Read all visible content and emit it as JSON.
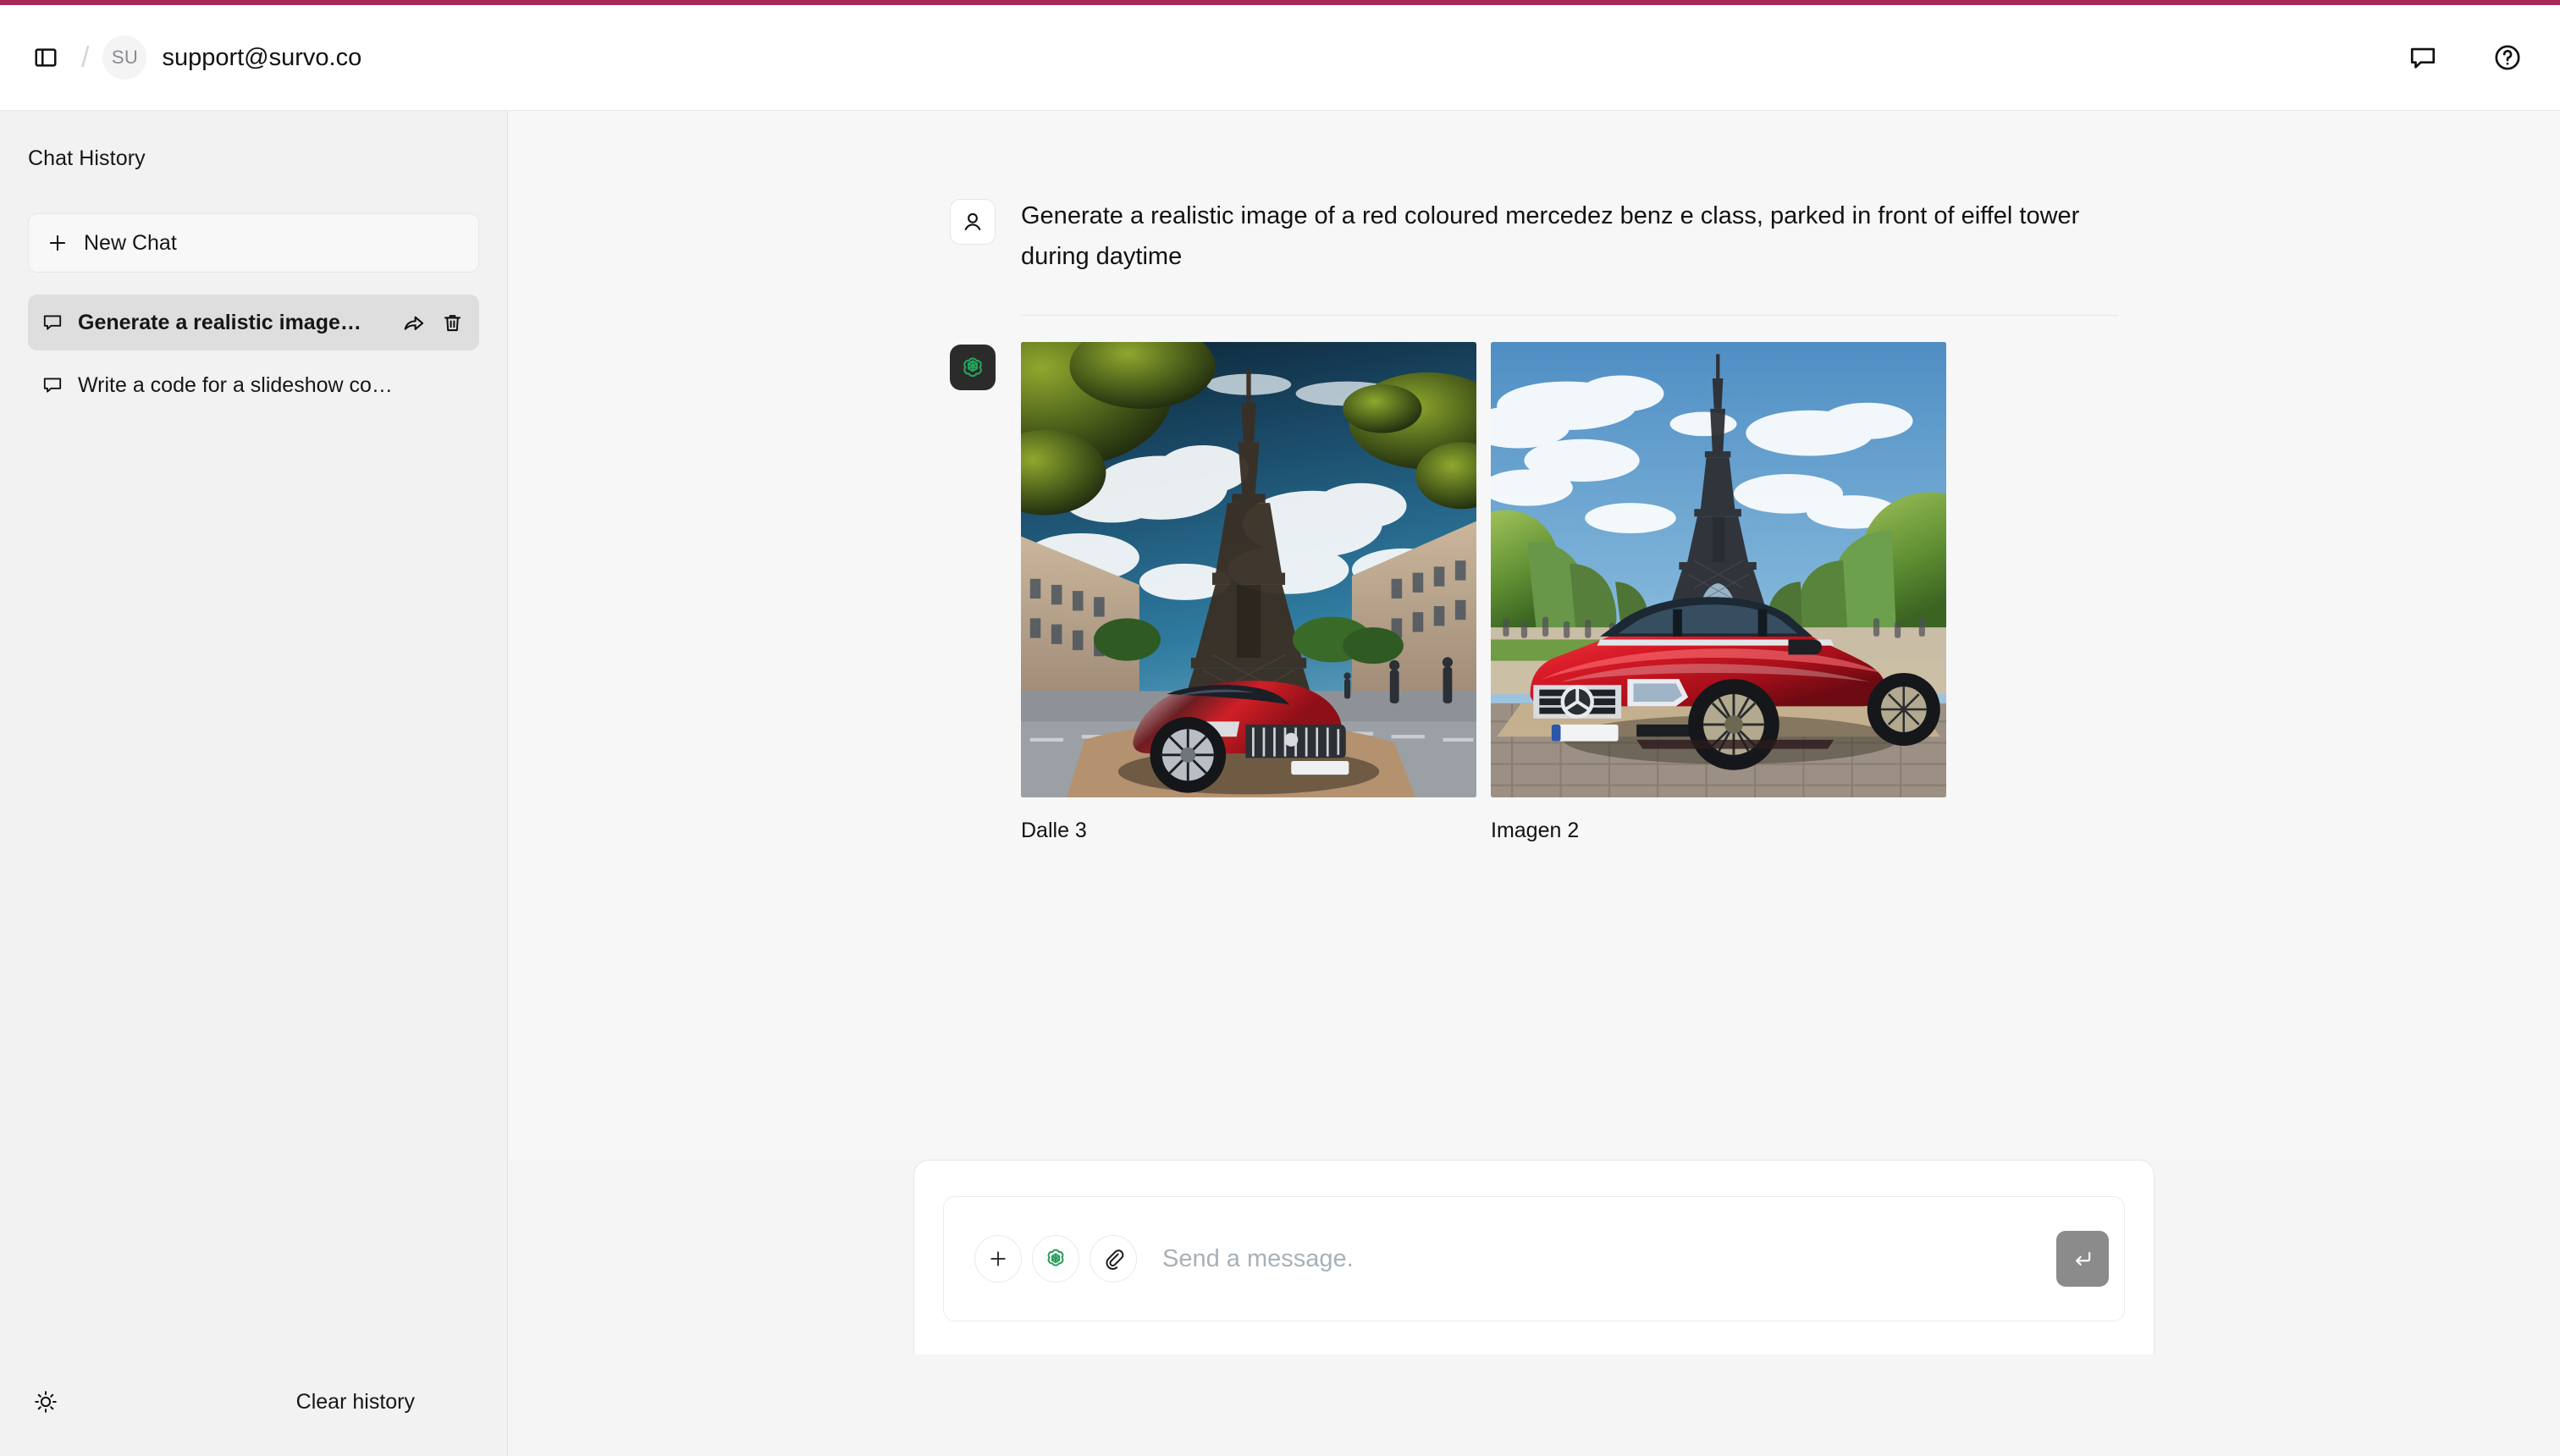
{
  "theme": {
    "accent_bar_color": "#a8285c",
    "sidebar_bg": "#f2f2f2",
    "main_bg": "#f7f7f7",
    "active_item_bg": "#dededf",
    "brand_green": "#2a9d5c",
    "send_button_bg": "#8b8b8b"
  },
  "header": {
    "sidebar_toggle_icon": "panel-toggle-icon",
    "separator": "/",
    "avatar_initials": "SU",
    "workspace_name": "support@survo.co",
    "feedback_icon": "chat-bubble-icon",
    "help_icon": "help-circle-icon"
  },
  "sidebar": {
    "title": "Chat History",
    "new_chat": {
      "label": "New Chat",
      "icon": "plus-icon"
    },
    "items": [
      {
        "label": "Generate a realistic image…",
        "icon": "chat-bubble-icon",
        "active": true,
        "share_icon": "share-arrow-icon",
        "delete_icon": "trash-icon"
      },
      {
        "label": "Write a code for a slideshow co…",
        "icon": "chat-bubble-icon",
        "active": false
      }
    ],
    "footer": {
      "theme_toggle_icon": "sun-icon",
      "clear_history_label": "Clear history"
    }
  },
  "conversation": {
    "user_message": {
      "avatar_icon": "person-icon",
      "text": "Generate a realistic image of a red coloured mercedez benz e class, parked in front of eiffel tower during daytime"
    },
    "assistant_message": {
      "avatar_icon": "openai-logo-icon",
      "images": [
        {
          "caption": "Dalle 3",
          "alt": "Low angle view of the Eiffel Tower with dramatic clouds and a red chrome luxury sedan parked in a Paris plaza"
        },
        {
          "caption": "Imagen 2",
          "alt": "Red Mercedes-Benz E-Class parked on cobblestones in front of the Eiffel Tower flanked by green trees"
        }
      ]
    }
  },
  "composer": {
    "add_icon": "plus-icon",
    "model_icon": "openai-logo-icon",
    "attach_icon": "paperclip-icon",
    "placeholder": "Send a message.",
    "value": "",
    "send_icon": "return-arrow-icon"
  }
}
